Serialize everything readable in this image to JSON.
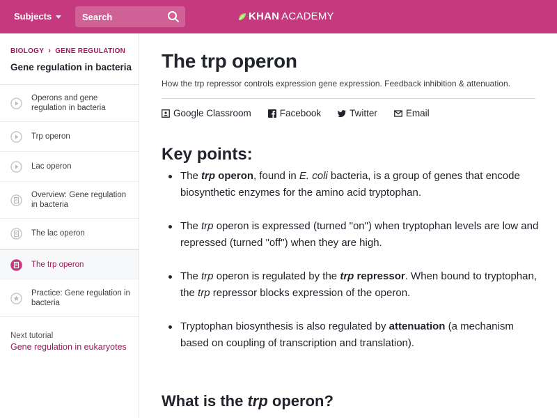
{
  "header": {
    "subjects_label": "Subjects",
    "search_placeholder": "Search",
    "logo_khan": "KHAN",
    "logo_academy": "ACADEMY",
    "bg_color": "#c53a7e"
  },
  "sidebar": {
    "breadcrumb": [
      "BIOLOGY",
      "GENE REGULATION"
    ],
    "tutorial_title": "Gene regulation in bacteria",
    "items": [
      {
        "label": "Operons and gene regulation in bacteria",
        "icon": "play-circle-icon"
      },
      {
        "label": "Trp operon",
        "icon": "play-circle-icon"
      },
      {
        "label": "Lac operon",
        "icon": "play-circle-icon"
      },
      {
        "label": "Overview: Gene regulation in bacteria",
        "icon": "article-icon"
      },
      {
        "label": "The lac operon",
        "icon": "article-icon"
      },
      {
        "label": "The trp operon",
        "icon": "article-icon",
        "active": true
      },
      {
        "label": "Practice: Gene regulation in bacteria",
        "icon": "star-icon"
      }
    ],
    "next_label": "Next tutorial",
    "next_link": "Gene regulation in eukaryotes"
  },
  "article": {
    "title": "The trp operon",
    "subtitle": "How the trp repressor controls expression gene expression. Feedback inhibition & attenuation.",
    "share": [
      "Google Classroom",
      "Facebook",
      "Twitter",
      "Email"
    ],
    "key_points_heading": "Key points:",
    "points": [
      {
        "t1": "The ",
        "t2": "trp",
        "t3": " operon",
        "t4": ", found in ",
        "t5": "E. coli",
        "t6": " bacteria, is a group of genes that encode biosynthetic enzymes for the amino acid tryptophan."
      },
      {
        "t1": "The ",
        "t2": "trp",
        "t3": " operon is expressed (turned \"on\") when tryptophan levels are low and repressed (turned \"off\") when they are high."
      },
      {
        "t1": "The ",
        "t2": "trp",
        "t3": " operon is regulated by the ",
        "t4": "trp",
        "t5": " repressor",
        "t6": ". When bound to tryptophan, the ",
        "t7": "trp",
        "t8": " repressor blocks expression of the operon."
      },
      {
        "t1": "Tryptophan biosynthesis is also regulated by ",
        "t2": "attenuation",
        "t3": " (a mechanism based on coupling of transcription and translation)."
      }
    ],
    "section_heading_pre": "What is the ",
    "section_heading_em": "trp",
    "section_heading_post": " operon?"
  },
  "colors": {
    "brand": "#c53a7e",
    "accent_text": "#a3195b",
    "text": "#21242c"
  }
}
